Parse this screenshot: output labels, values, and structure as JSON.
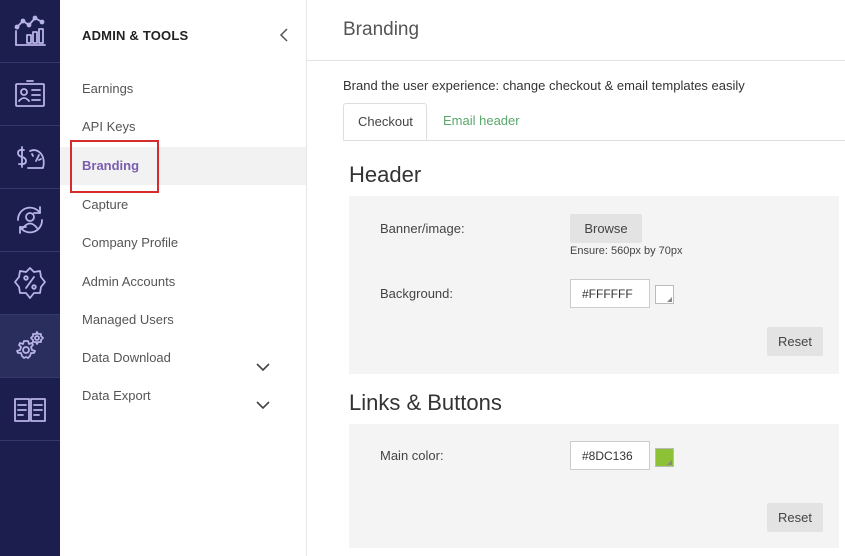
{
  "rail": {
    "items": [
      {
        "icon": "analytics-chart-icon"
      },
      {
        "icon": "contact-card-icon"
      },
      {
        "icon": "dollar-speedometer-icon"
      },
      {
        "icon": "user-refresh-icon"
      },
      {
        "icon": "percent-badge-icon"
      },
      {
        "icon": "gear-settings-icon"
      },
      {
        "icon": "open-book-icon"
      }
    ],
    "active_index": 5
  },
  "sidebar": {
    "title": "ADMIN & TOOLS",
    "items": [
      {
        "label": "Earnings"
      },
      {
        "label": "API Keys"
      },
      {
        "label": "Branding",
        "active": true
      },
      {
        "label": "Capture"
      },
      {
        "label": "Company Profile"
      },
      {
        "label": "Admin Accounts"
      },
      {
        "label": "Managed Users"
      },
      {
        "label": "Data Download",
        "expandable": true
      },
      {
        "label": "Data Export",
        "expandable": true
      }
    ]
  },
  "main": {
    "title": "Branding",
    "description": "Brand the user experience: change checkout & email templates easily",
    "tabs": [
      {
        "label": "Checkout",
        "active": true
      },
      {
        "label": "Email header",
        "active": false
      }
    ],
    "header_section": {
      "title": "Header",
      "banner_label": "Banner/image:",
      "browse_label": "Browse",
      "ensure_hint": "Ensure: 560px by 70px",
      "background_label": "Background:",
      "background_value": "#FFFFFF",
      "reset_label": "Reset"
    },
    "links_section": {
      "title": "Links & Buttons",
      "main_color_label": "Main color:",
      "main_color_value": "#8DC136",
      "reset_label": "Reset"
    }
  },
  "colors": {
    "rail_bg": "#1c1f4d",
    "accent_purple": "#7a5cb0",
    "tab_green": "#5aa86b",
    "highlight_red": "#d62c2c"
  }
}
